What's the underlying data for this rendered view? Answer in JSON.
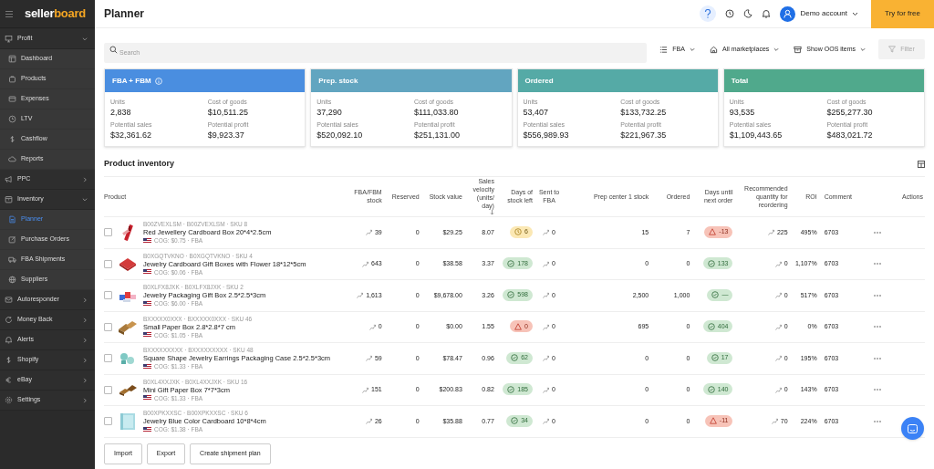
{
  "brand": {
    "part_1": "seller",
    "part_2": "board"
  },
  "sidebar": {
    "items": [
      {
        "label": "Profit",
        "expanded": true,
        "children": [
          {
            "label": "Dashboard",
            "selected": false
          },
          {
            "label": "Products",
            "selected": false
          },
          {
            "label": "Expenses",
            "selected": false
          },
          {
            "label": "LTV",
            "selected": false
          },
          {
            "label": "Cashflow",
            "selected": false
          },
          {
            "label": "Reports",
            "selected": false
          }
        ]
      },
      {
        "label": "PPC",
        "expanded": false
      },
      {
        "label": "Inventory",
        "expanded": true,
        "children": [
          {
            "label": "Planner",
            "selected": true
          },
          {
            "label": "Purchase Orders",
            "selected": false
          },
          {
            "label": "FBA Shipments",
            "selected": false
          },
          {
            "label": "Suppliers",
            "selected": false
          }
        ]
      },
      {
        "label": "Autoresponder",
        "expanded": false
      },
      {
        "label": "Money Back",
        "expanded": false
      },
      {
        "label": "Alerts",
        "expanded": false
      },
      {
        "label": "Shopify",
        "expanded": false
      },
      {
        "label": "eBay",
        "expanded": false
      },
      {
        "label": "Settings",
        "expanded": false
      }
    ]
  },
  "header": {
    "title": "Planner",
    "account": "Demo account",
    "try_button": "Try for free"
  },
  "toolbar": {
    "search": {
      "placeholder": "Search"
    },
    "dropdowns": [
      "FBA",
      "All marketplaces",
      "Show OOS items"
    ],
    "filter": {
      "label": "Filter",
      "disabled": true
    }
  },
  "cards": [
    {
      "title": "FBA + FBM",
      "info": true,
      "color": "#4a8ee0",
      "fields": [
        {
          "label": "Units",
          "value": "2,838"
        },
        {
          "label": "Cost of goods",
          "value": "$10,511.25"
        },
        {
          "label": "Potential sales",
          "value": "$32,361.62"
        },
        {
          "label": "Potential profit",
          "value": "$9,923.37"
        }
      ]
    },
    {
      "title": "Prep. stock",
      "info": false,
      "color": "#62a5c0",
      "fields": [
        {
          "label": "Units",
          "value": "37,290"
        },
        {
          "label": "Cost of goods",
          "value": "$111,033.80"
        },
        {
          "label": "Potential sales",
          "value": "$520,092.10"
        },
        {
          "label": "Potential profit",
          "value": "$251,131.00"
        }
      ]
    },
    {
      "title": "Ordered",
      "info": false,
      "color": "#55aaa6",
      "fields": [
        {
          "label": "Units",
          "value": "53,407"
        },
        {
          "label": "Cost of goods",
          "value": "$133,732.25"
        },
        {
          "label": "Potential sales",
          "value": "$556,989.93"
        },
        {
          "label": "Potential profit",
          "value": "$221,967.35"
        }
      ]
    },
    {
      "title": "Total",
      "info": false,
      "color": "#50a98c",
      "fields": [
        {
          "label": "Units",
          "value": "93,535"
        },
        {
          "label": "Cost of goods",
          "value": "$255,277.30"
        },
        {
          "label": "Potential sales",
          "value": "$1,109,443.65"
        },
        {
          "label": "Potential profit",
          "value": "$483,021.72"
        }
      ]
    }
  ],
  "table": {
    "title": "Product inventory",
    "columns": [
      "Product",
      "FBA/FBM stock",
      "Reserved",
      "Stock value",
      "Sales velocity (units/ day)",
      "Days of stock left",
      "Sent to FBA",
      "Prep center 1 stock",
      "Ordered",
      "Days until next order",
      "Recommended quantity for reordering",
      "ROI",
      "Comment",
      "Actions"
    ],
    "rows": [
      {
        "checked": false,
        "ids": "B00ZVEXLSM · B00ZVEXLSM · SKU 8",
        "name": "Red Jewellery Cardboard Box 20*4*2.5cm",
        "cog": "COG: $0.75 · FBA",
        "fba_stock": "39",
        "reserved": "0",
        "stock_value": "$29.25",
        "velocity": "8.07",
        "days_left": {
          "value": "6",
          "kind": "warning"
        },
        "sent_to_fba": "0",
        "prep_stock": "15",
        "ordered": "7",
        "days_until": {
          "value": "-13",
          "kind": "alert"
        },
        "recommended": "225",
        "roi": "495%",
        "comment": "6703"
      },
      {
        "checked": false,
        "ids": "B0XGQTVKNO · B0XGQTVKNO · SKU 4",
        "name": "Jewelry Cardboard Gift Boxes with Flower 18*12*5cm",
        "cog": "COG: $0.06 · FBA",
        "fba_stock": "643",
        "reserved": "0",
        "stock_value": "$38.58",
        "velocity": "3.37",
        "days_left": {
          "value": "178",
          "kind": "ok"
        },
        "sent_to_fba": "0",
        "prep_stock": "0",
        "ordered": "0",
        "days_until": {
          "value": "133",
          "kind": "ok"
        },
        "recommended": "0",
        "roi": "1,107%",
        "comment": "6703"
      },
      {
        "checked": false,
        "ids": "B0XLFX8JXK · B0XLFX8JXK · SKU 2",
        "name": "Jewelry Packaging Gift Box 2.5*2.5*3cm",
        "cog": "COG: $6.00 · FBA",
        "fba_stock": "1,613",
        "reserved": "0",
        "stock_value": "$9,678.00",
        "velocity": "3.26",
        "days_left": {
          "value": "598",
          "kind": "ok"
        },
        "sent_to_fba": "0",
        "prep_stock": "2,500",
        "ordered": "1,000",
        "days_until": {
          "value": "—",
          "kind": "ok"
        },
        "recommended": "0",
        "roi": "517%",
        "comment": "6703"
      },
      {
        "checked": false,
        "ids": "BXXXXX0XXX · BXXXXX0XXX · SKU 46",
        "name": "Small Paper Box 2.8*2.8*7 cm",
        "cog": "COG: $1.05 · FBA",
        "fba_stock": "0",
        "reserved": "0",
        "stock_value": "$0.00",
        "velocity": "1.55",
        "days_left": {
          "value": "0",
          "kind": "alert"
        },
        "sent_to_fba": "0",
        "prep_stock": "695",
        "ordered": "0",
        "days_until": {
          "value": "404",
          "kind": "ok"
        },
        "recommended": "0",
        "roi": "0%",
        "comment": "6703"
      },
      {
        "checked": false,
        "ids": "BXXXXXXXXX · BXXXXXXXXX · SKU 48",
        "name": "Square Shape Jewelry Earrings Packaging Case 2.5*2.5*3cm",
        "cog": "COG: $1.33 · FBA",
        "fba_stock": "59",
        "reserved": "0",
        "stock_value": "$78.47",
        "velocity": "0.96",
        "days_left": {
          "value": "62",
          "kind": "ok"
        },
        "sent_to_fba": "0",
        "prep_stock": "0",
        "ordered": "0",
        "days_until": {
          "value": "17",
          "kind": "ok"
        },
        "recommended": "0",
        "roi": "195%",
        "comment": "6703"
      },
      {
        "checked": false,
        "ids": "B0XL4XXJXK · B0XL4XXJXK · SKU 16",
        "name": "Mini Gift Paper Box 7*7*3cm",
        "cog": "COG: $1.33 · FBA",
        "fba_stock": "151",
        "reserved": "0",
        "stock_value": "$200.83",
        "velocity": "0.82",
        "days_left": {
          "value": "185",
          "kind": "ok"
        },
        "sent_to_fba": "0",
        "prep_stock": "0",
        "ordered": "0",
        "days_until": {
          "value": "140",
          "kind": "ok"
        },
        "recommended": "0",
        "roi": "143%",
        "comment": "6703"
      },
      {
        "checked": false,
        "ids": "B00XPKXXSC · B00XPKXXSC · SKU 6",
        "name": "Jewelry Blue Color Cardboard 10*8*4cm",
        "cog": "COG: $1.38 · FBA",
        "fba_stock": "26",
        "reserved": "0",
        "stock_value": "$35.88",
        "velocity": "0.77",
        "days_left": {
          "value": "34",
          "kind": "ok"
        },
        "sent_to_fba": "0",
        "prep_stock": "0",
        "ordered": "0",
        "days_until": {
          "value": "-11",
          "kind": "alert"
        },
        "recommended": "70",
        "roi": "224%",
        "comment": "6703"
      }
    ]
  },
  "footer_buttons": [
    "Import",
    "Export",
    "Create shipment plan"
  ]
}
